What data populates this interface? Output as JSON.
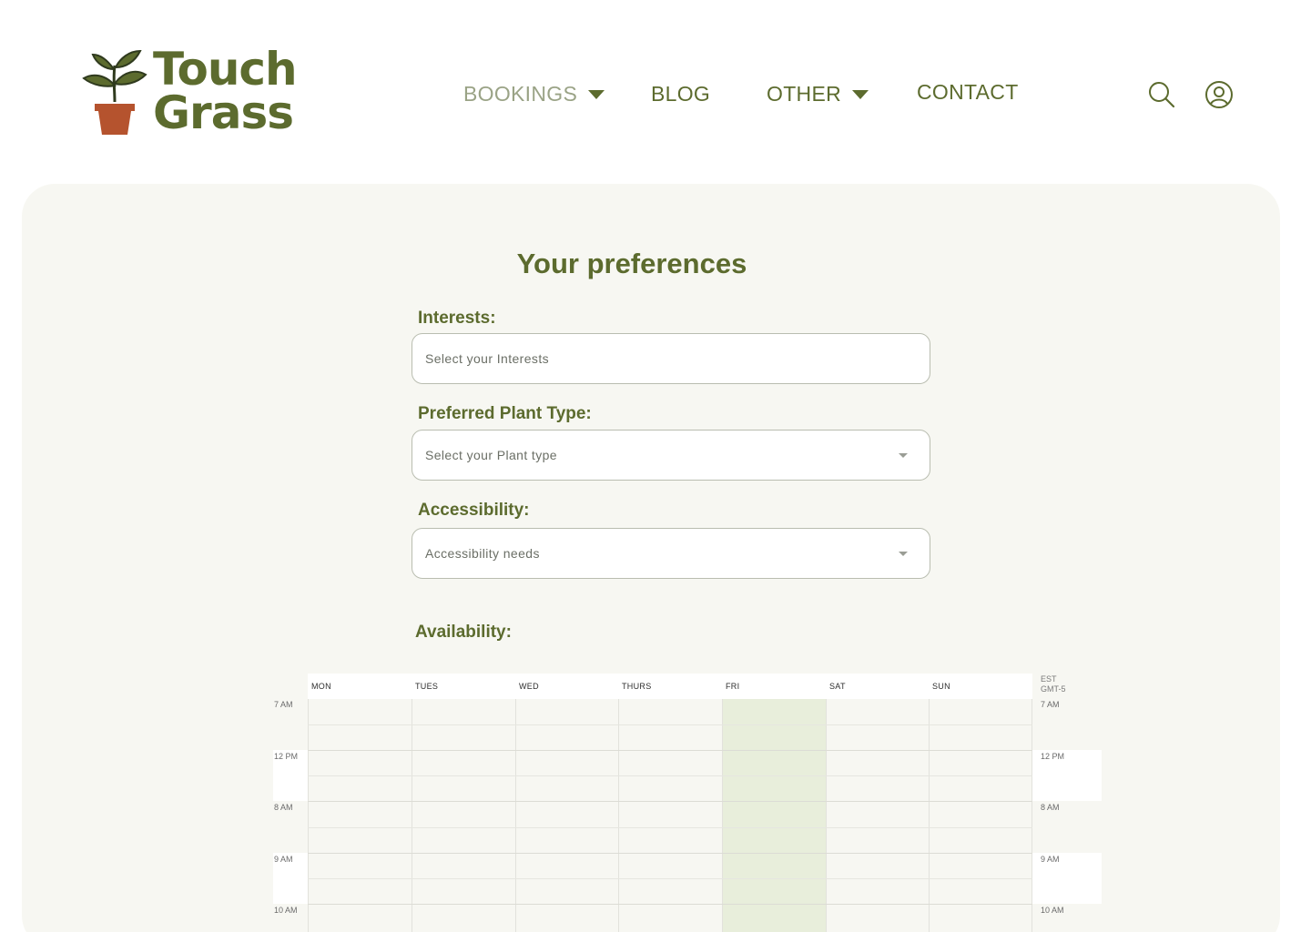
{
  "brand": {
    "name_line1": "Touch",
    "name_line2": "Grass"
  },
  "nav": {
    "items": [
      {
        "label": "BOOKINGS",
        "dropdown": true,
        "muted": true
      },
      {
        "label": "BLOG",
        "dropdown": false,
        "muted": false
      },
      {
        "label": "OTHER",
        "dropdown": true,
        "muted": false
      },
      {
        "label": "CONTACT",
        "dropdown": false,
        "muted": false
      }
    ],
    "icons": [
      "search-icon",
      "user-account-icon"
    ]
  },
  "preferences": {
    "title": "Your preferences",
    "interests": {
      "label": "Interests:",
      "placeholder": "Select your Interests"
    },
    "plant_type": {
      "label": "Preferred Plant Type:",
      "placeholder": "Select your Plant type"
    },
    "accessibility": {
      "label": "Accessibility:",
      "placeholder": "Accessibility needs"
    },
    "availability": {
      "label": "Availability:"
    }
  },
  "calendar": {
    "days": [
      "MON",
      "TUES",
      "WED",
      "THURS",
      "FRI",
      "SAT",
      "SUN"
    ],
    "selected_day": "FRI",
    "timezone_line1": "EST",
    "timezone_line2": "GMT-5",
    "hours_left": [
      "7 AM",
      "12 PM",
      "8 AM",
      "9 AM",
      "10 AM"
    ],
    "hours_right": [
      "7 AM",
      "12 PM",
      "8 AM",
      "9 AM",
      "10 AM"
    ]
  },
  "colors": {
    "brand_green": "#5c6b2e",
    "muted_nav": "#9aa386",
    "card_bg": "#f7f7f2",
    "selected_day": "#e8eedb",
    "pot": "#b5532e"
  }
}
